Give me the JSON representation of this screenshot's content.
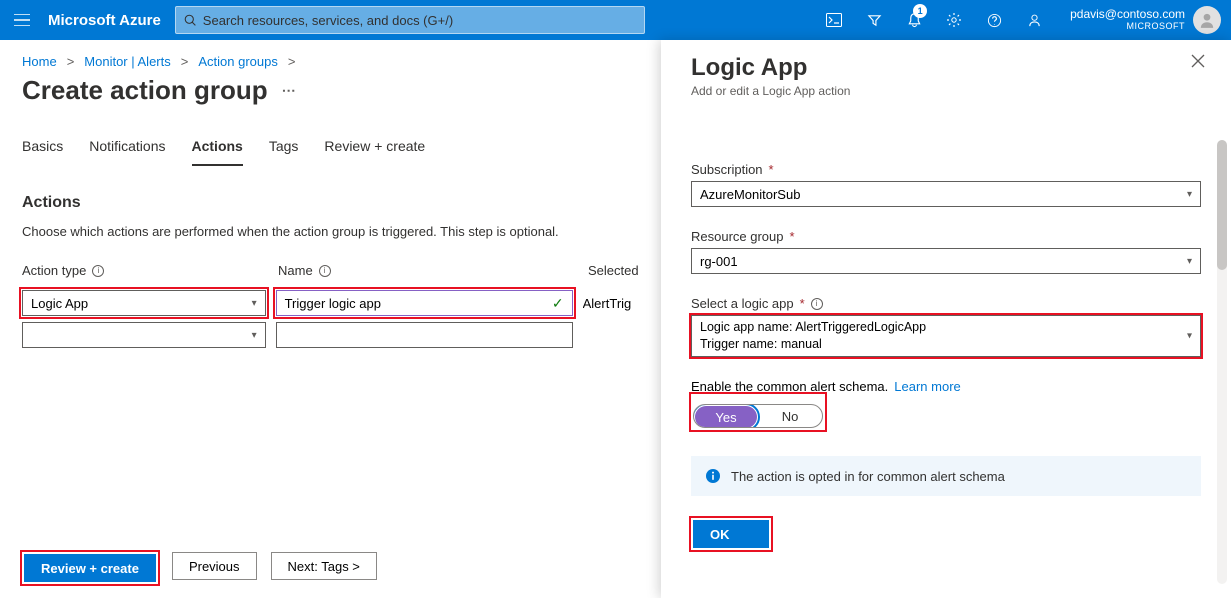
{
  "header": {
    "brand": "Microsoft Azure",
    "search_placeholder": "Search resources, services, and docs (G+/)",
    "notification_count": "1",
    "user_email": "pdavis@contoso.com",
    "user_tenant": "MICROSOFT"
  },
  "breadcrumb": {
    "items": [
      "Home",
      "Monitor | Alerts",
      "Action groups"
    ],
    "sep": ">"
  },
  "page": {
    "title": "Create action group",
    "tabs": [
      "Basics",
      "Notifications",
      "Actions",
      "Tags",
      "Review + create"
    ],
    "active_tab_index": 2
  },
  "actions": {
    "section_title": "Actions",
    "description": "Choose which actions are performed when the action group is triggered. This step is optional.",
    "headers": {
      "type": "Action type",
      "name": "Name",
      "selected": "Selected"
    },
    "rows": [
      {
        "type": "Logic App",
        "name": "Trigger logic app",
        "selected": "AlertTrig",
        "valid": true
      },
      {
        "type": "",
        "name": "",
        "selected": "",
        "valid": false
      }
    ]
  },
  "footer": {
    "review": "Review + create",
    "previous": "Previous",
    "next": "Next: Tags  >"
  },
  "panel": {
    "title": "Logic App",
    "subtitle": "Add or edit a Logic App action",
    "subscription_label": "Subscription",
    "subscription_value": "AzureMonitorSub",
    "rg_label": "Resource group",
    "rg_value": "rg-001",
    "la_label": "Select a logic app",
    "la_line1": "Logic app name: AlertTriggeredLogicApp",
    "la_line2": "Trigger name: manual",
    "schema_text": "Enable the common alert schema.",
    "learn_more": "Learn more",
    "toggle_yes": "Yes",
    "toggle_no": "No",
    "info_text": "The action is opted in for common alert schema",
    "ok": "OK"
  }
}
